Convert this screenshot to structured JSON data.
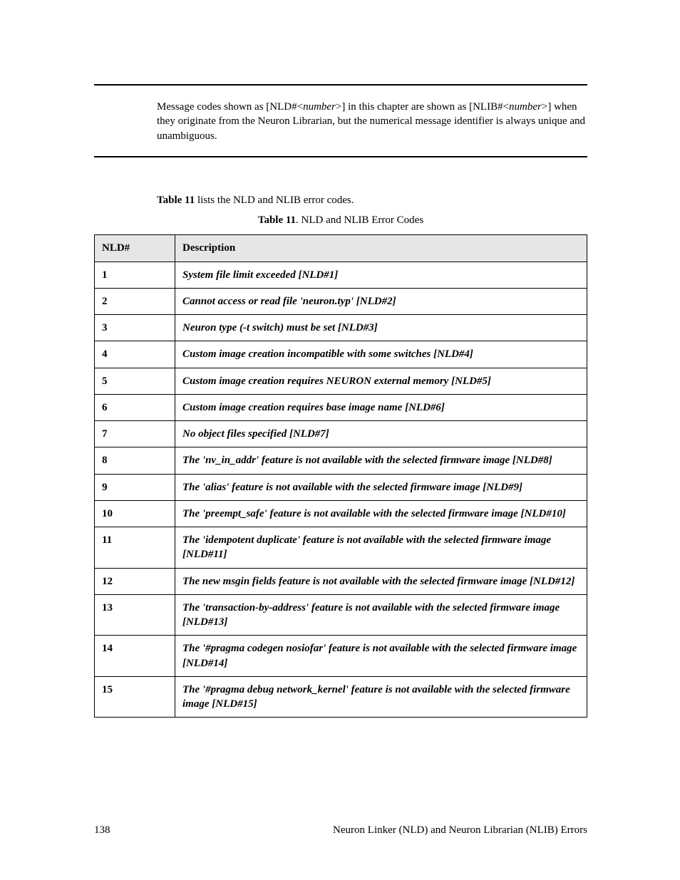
{
  "note": {
    "part1": "Message codes shown as [NLD#<",
    "part2": "number",
    "part3": ">] in this chapter are shown as [NLIB#<",
    "part4": "number",
    "part5": ">] when they originate from the Neuron Librarian, but the numerical message identifier is always unique and unambiguous."
  },
  "intro": {
    "ref": "Table 11",
    "rest": " lists the NLD and NLIB error codes."
  },
  "caption": {
    "bold": "Table 11",
    "rest": ". NLD and NLIB Error Codes"
  },
  "headers": {
    "c1": "NLD#",
    "c2": "Description"
  },
  "rows": [
    {
      "n": "1",
      "d": "System file limit exceeded [NLD#1]"
    },
    {
      "n": "2",
      "d": "Cannot access or read file 'neuron.typ' [NLD#2]"
    },
    {
      "n": "3",
      "d": "Neuron type (-t switch) must be set [NLD#3]"
    },
    {
      "n": "4",
      "d": "Custom image creation incompatible with some switches [NLD#4]"
    },
    {
      "n": "5",
      "d": "Custom image creation requires NEURON external memory [NLD#5]"
    },
    {
      "n": "6",
      "d": "Custom image creation requires base image name [NLD#6]"
    },
    {
      "n": "7",
      "d": "No object files specified [NLD#7]"
    },
    {
      "n": "8",
      "d": "The 'nv_in_addr' feature is not available with the selected firmware image [NLD#8]"
    },
    {
      "n": "9",
      "d": "The 'alias' feature is not available with the selected firmware image [NLD#9]"
    },
    {
      "n": "10",
      "d": "The 'preempt_safe' feature is not available with the selected firmware image [NLD#10]"
    },
    {
      "n": "11",
      "d": "The 'idempotent duplicate' feature is not available with the selected firmware image [NLD#11]"
    },
    {
      "n": "12",
      "d": "The new msgin fields feature is not available with the selected firmware image [NLD#12]"
    },
    {
      "n": "13",
      "d": "The 'transaction-by-address' feature is not available with the selected firmware image [NLD#13]"
    },
    {
      "n": "14",
      "d": "The '#pragma codegen nosiofar' feature is not available with the selected firmware image [NLD#14]"
    },
    {
      "n": "15",
      "d": "The '#pragma debug network_kernel' feature is not available with the selected firmware image [NLD#15]"
    }
  ],
  "footer": {
    "page": "138",
    "title": "Neuron Linker (NLD) and Neuron Librarian (NLIB) Errors"
  }
}
